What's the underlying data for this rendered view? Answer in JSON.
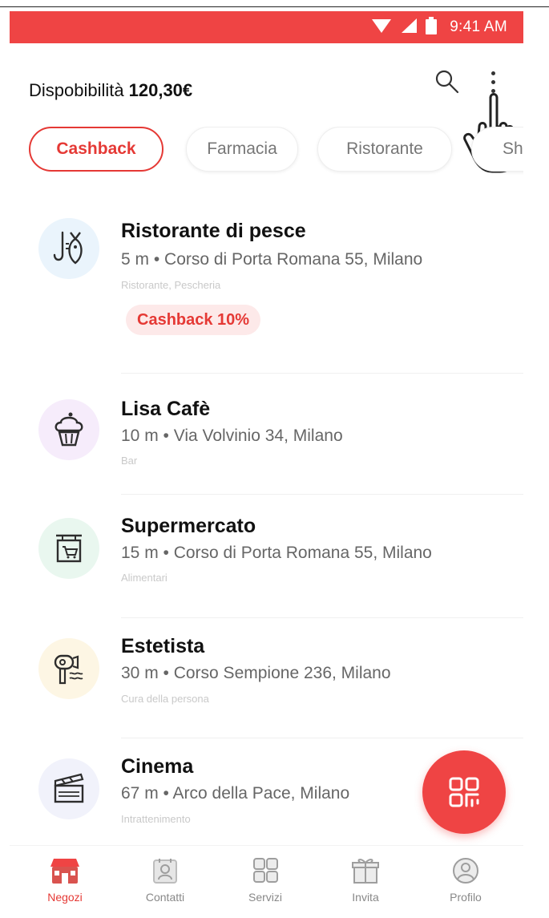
{
  "status_bar": {
    "time": "9:41 AM",
    "icons": [
      "wifi-icon",
      "signal-icon",
      "battery-icon"
    ],
    "color": "#ef4444"
  },
  "header": {
    "balance_label": "Dispobibilità",
    "balance_value": "120,30€",
    "icons": [
      "search-icon",
      "more-vert-icon"
    ]
  },
  "tabs": [
    {
      "label": "Cashback",
      "active": true
    },
    {
      "label": "Farmacia",
      "active": false
    },
    {
      "label": "Ristorante",
      "active": false
    },
    {
      "label": "Sho",
      "active": false
    }
  ],
  "stores": [
    {
      "title": "Ristorante di pesce",
      "address": "5 m • Corso di Porta Romana 55, Milano",
      "category": "Ristorante, Pescheria",
      "badge": "Cashback 10%",
      "icon": "fish-icon",
      "icon_bg": "#eaf4fc"
    },
    {
      "title": "Lisa Cafè",
      "address": "10 m • Via Volvinio 34, Milano",
      "category": "Bar",
      "icon": "cupcake-icon",
      "icon_bg": "#f6ecfb"
    },
    {
      "title": "Supermercato",
      "address": "15 m • Corso di Porta Romana 55, Milano",
      "category": "Alimentari",
      "icon": "shop-sign-icon",
      "icon_bg": "#e9f7ef"
    },
    {
      "title": "Estetista",
      "address": "30 m • Corso Sempione 236, Milano",
      "category": "Cura della persona",
      "icon": "hair-dryer-icon",
      "icon_bg": "#fdf6e4"
    },
    {
      "title": "Cinema",
      "address": "67 m • Arco della Pace, Milano",
      "category": "Intrattenimento",
      "icon": "clapperboard-icon",
      "icon_bg": "#f1f2fb"
    }
  ],
  "fab": {
    "icon": "qr-code-icon",
    "color": "#ef4444"
  },
  "bottom_nav": [
    {
      "label": "Negozi",
      "icon": "store-icon",
      "active": true
    },
    {
      "label": "Contatti",
      "icon": "contacts-icon",
      "active": false
    },
    {
      "label": "Servizi",
      "icon": "grid-icon",
      "active": false
    },
    {
      "label": "Invita",
      "icon": "gift-icon",
      "active": false
    },
    {
      "label": "Profilo",
      "icon": "profile-icon",
      "active": false
    }
  ],
  "accent_color": "#e53935"
}
